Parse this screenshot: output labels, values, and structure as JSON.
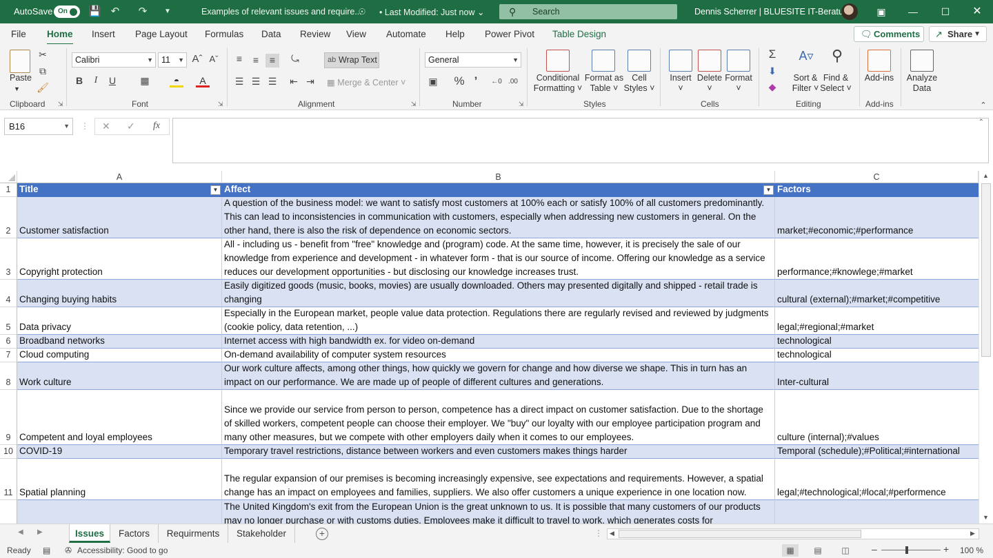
{
  "titlebar": {
    "autosave_label": "AutoSave",
    "autosave_state": "On",
    "doc_title": "Examples of relevant issues and require...",
    "last_modified": "Last Modified: Just now",
    "search_placeholder": "Search",
    "user_name": "Dennis Scherrer | BLUESITE IT-Beratung"
  },
  "ribbon_tabs": [
    "File",
    "Home",
    "Insert",
    "Page Layout",
    "Formulas",
    "Data",
    "Review",
    "View",
    "Automate",
    "Help",
    "Power Pivot",
    "Table Design"
  ],
  "active_tab": "Home",
  "actions": {
    "comments": "Comments",
    "share": "Share"
  },
  "ribbon": {
    "clipboard": {
      "paste": "Paste",
      "label": "Clipboard"
    },
    "font": {
      "name": "Calibri",
      "size": "11",
      "label": "Font"
    },
    "alignment": {
      "wrap_text": "Wrap Text",
      "merge_center": "Merge & Center",
      "label": "Alignment"
    },
    "number": {
      "format": "General",
      "label": "Number"
    },
    "styles": {
      "conditional_1": "Conditional",
      "conditional_2": "Formatting",
      "format_table_1": "Format as",
      "format_table_2": "Table",
      "cell_styles_1": "Cell",
      "cell_styles_2": "Styles",
      "label": "Styles"
    },
    "cells": {
      "insert": "Insert",
      "delete": "Delete",
      "format": "Format",
      "label": "Cells"
    },
    "editing": {
      "sort_1": "Sort &",
      "sort_2": "Filter",
      "find_1": "Find &",
      "find_2": "Select",
      "label": "Editing"
    },
    "addins": {
      "addins": "Add-ins",
      "label": "Add-ins"
    },
    "analyze": {
      "line1": "Analyze",
      "line2": "Data"
    }
  },
  "formula_bar": {
    "name_box": "B16",
    "fx": "fx",
    "content": ""
  },
  "columns": [
    "A",
    "B",
    "C"
  ],
  "table": {
    "headers": [
      "Title",
      "Affect",
      "Factors"
    ],
    "rows": [
      {
        "num": "2",
        "title": "Customer satisfaction",
        "affect": "A question of the business model: we want to satisfy most customers at 100% each or satisfy 100% of all customers predominantly. This can lead to inconsistencies in communication with customers, especially when addressing new customers in general. On the other hand, there is also the risk of dependence on economic sectors.",
        "factors": "market;#economic;#performance"
      },
      {
        "num": "3",
        "title": "Copyright protection",
        "affect": "All - including us - benefit from \"free\" knowledge and (program) code. At the same time, however, it is precisely the sale of our knowledge from experience and development - in whatever form - that is our source of income. Offering our knowledge as a service reduces our development opportunities - but disclosing our knowledge increases trust.",
        "factors": "performance;#knowlege;#market"
      },
      {
        "num": "4",
        "title": "Changing buying habits",
        "affect": "Easily digitized goods (music, books, movies) are usually downloaded. Others may presented digitally and shipped - retail trade is changing",
        "factors": "cultural (external);#market;#competitive"
      },
      {
        "num": "5",
        "title": "Data privacy",
        "affect": "Especially in the European market, people value data protection. Regulations there are regularly revised and reviewed by judgments (cookie policy, data retention, ...)",
        "factors": "legal;#regional;#market"
      },
      {
        "num": "6",
        "title": "Broadband networks",
        "affect": "Internet access with high bandwidth ex. for video on-demand",
        "factors": "technological"
      },
      {
        "num": "7",
        "title": "Cloud computing",
        "affect": "On-demand availability of computer system resources",
        "factors": "technological"
      },
      {
        "num": "8",
        "title": "Work culture",
        "affect": "Our work culture affects, among other things, how quickly we govern for change and how diverse we shape. This in turn has an impact on our performance. We are made up of people of different cultures and generations.",
        "factors": "Inter-cultural"
      },
      {
        "num": "9",
        "title": "Competent and loyal employees",
        "affect": "Since we provide our service from person to person, competence has a direct impact on customer satisfaction. Due to the shortage of skilled workers, competent people can choose their employer. We \"buy\" our loyalty with our employee participation program and many other measures, but we compete with other employers daily when it comes to our employees.",
        "factors": "culture (internal);#values"
      },
      {
        "num": "10",
        "title": "COVID-19",
        "affect": "Temporary travel restrictions, distance between workers and even customers makes things harder",
        "factors": "Temporal (schedule);#Political;#international"
      },
      {
        "num": "11",
        "title": "Spatial planning",
        "affect": "The regular expansion of our premises is becoming increasingly expensive, see expectations and requirements. However, a spatial change has an impact on employees and families, suppliers. We also offer customers a unique experience in one location now.",
        "factors": "legal;#technological;#local;#performence"
      },
      {
        "num": "",
        "title": "",
        "affect": "The United Kingdom's exit from the European Union is the great unknown to us. It is possible that many customers of our products may no longer purchase or with customs duties. Employees make it difficult to travel to work, which generates costs for",
        "factors": ""
      }
    ]
  },
  "sheets": [
    "Issues",
    "Factors",
    "Requirments",
    "Stakeholder"
  ],
  "active_sheet": "Issues",
  "status": {
    "ready": "Ready",
    "accessibility": "Accessibility: Good to go",
    "zoom": "100 %"
  }
}
